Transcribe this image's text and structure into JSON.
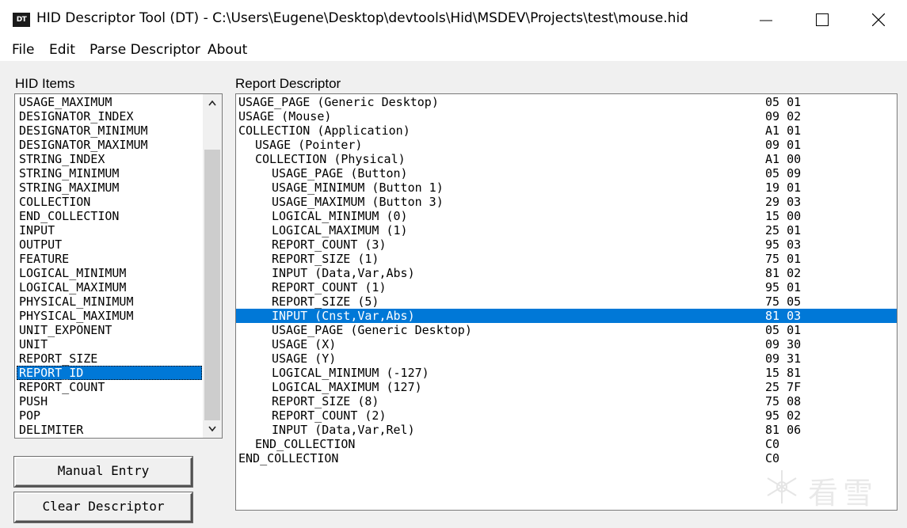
{
  "window": {
    "title": "HID Descriptor Tool (DT) - C:\\Users\\Eugene\\Desktop\\devtools\\Hid\\MSDEV\\Projects\\test\\mouse.hid",
    "icon_label": "DT"
  },
  "menu": [
    "File",
    "Edit",
    "Parse Descriptor",
    "About"
  ],
  "hid_items": {
    "label": "HID Items",
    "items": [
      "USAGE_MAXIMUM",
      "DESIGNATOR_INDEX",
      "DESIGNATOR_MINIMUM",
      "DESIGNATOR_MAXIMUM",
      "STRING_INDEX",
      "STRING_MINIMUM",
      "STRING_MAXIMUM",
      "COLLECTION",
      "END_COLLECTION",
      "INPUT",
      "OUTPUT",
      "FEATURE",
      "LOGICAL_MINIMUM",
      "LOGICAL_MAXIMUM",
      "PHYSICAL_MINIMUM",
      "PHYSICAL_MAXIMUM",
      "UNIT_EXPONENT",
      "UNIT",
      "REPORT_SIZE",
      "REPORT_ID",
      "REPORT_COUNT",
      "PUSH",
      "POP",
      "DELIMITER"
    ],
    "selected_index": 19
  },
  "buttons": {
    "manual_entry": "Manual Entry",
    "clear_descriptor": "Clear Descriptor"
  },
  "report_descriptor": {
    "label": "Report Descriptor",
    "selected_index": 15,
    "rows": [
      {
        "item": "USAGE_PAGE (Generic Desktop)",
        "indent": 0,
        "bytes": "05 01"
      },
      {
        "item": "USAGE (Mouse)",
        "indent": 0,
        "bytes": "09 02"
      },
      {
        "item": "COLLECTION (Application)",
        "indent": 0,
        "bytes": "A1 01"
      },
      {
        "item": "USAGE (Pointer)",
        "indent": 1,
        "bytes": "09 01"
      },
      {
        "item": "COLLECTION (Physical)",
        "indent": 1,
        "bytes": "A1 00"
      },
      {
        "item": "USAGE_PAGE (Button)",
        "indent": 2,
        "bytes": "05 09"
      },
      {
        "item": "USAGE_MINIMUM (Button 1)",
        "indent": 2,
        "bytes": "19 01"
      },
      {
        "item": "USAGE_MAXIMUM (Button 3)",
        "indent": 2,
        "bytes": "29 03"
      },
      {
        "item": "LOGICAL_MINIMUM (0)",
        "indent": 2,
        "bytes": "15 00"
      },
      {
        "item": "LOGICAL_MAXIMUM (1)",
        "indent": 2,
        "bytes": "25 01"
      },
      {
        "item": "REPORT_COUNT (3)",
        "indent": 2,
        "bytes": "95 03"
      },
      {
        "item": "REPORT_SIZE (1)",
        "indent": 2,
        "bytes": "75 01"
      },
      {
        "item": "INPUT (Data,Var,Abs)",
        "indent": 2,
        "bytes": "81 02"
      },
      {
        "item": "REPORT_COUNT (1)",
        "indent": 2,
        "bytes": "95 01"
      },
      {
        "item": "REPORT_SIZE (5)",
        "indent": 2,
        "bytes": "75 05"
      },
      {
        "item": "INPUT (Cnst,Var,Abs)",
        "indent": 2,
        "bytes": "81 03"
      },
      {
        "item": "USAGE_PAGE (Generic Desktop)",
        "indent": 2,
        "bytes": "05 01"
      },
      {
        "item": "USAGE (X)",
        "indent": 2,
        "bytes": "09 30"
      },
      {
        "item": "USAGE (Y)",
        "indent": 2,
        "bytes": "09 31"
      },
      {
        "item": "LOGICAL_MINIMUM (-127)",
        "indent": 2,
        "bytes": "15 81"
      },
      {
        "item": "LOGICAL_MAXIMUM (127)",
        "indent": 2,
        "bytes": "25 7F"
      },
      {
        "item": "REPORT_SIZE (8)",
        "indent": 2,
        "bytes": "75 08"
      },
      {
        "item": "REPORT_COUNT (2)",
        "indent": 2,
        "bytes": "95 02"
      },
      {
        "item": "INPUT (Data,Var,Rel)",
        "indent": 2,
        "bytes": "81 06"
      },
      {
        "item": "END_COLLECTION",
        "indent": 1,
        "bytes": "C0"
      },
      {
        "item": "END_COLLECTION",
        "indent": 0,
        "bytes": "C0"
      }
    ]
  },
  "watermark": {
    "text": "看雪"
  },
  "colors": {
    "selection": "#0078d7",
    "window_bg": "#f0f0f0"
  }
}
